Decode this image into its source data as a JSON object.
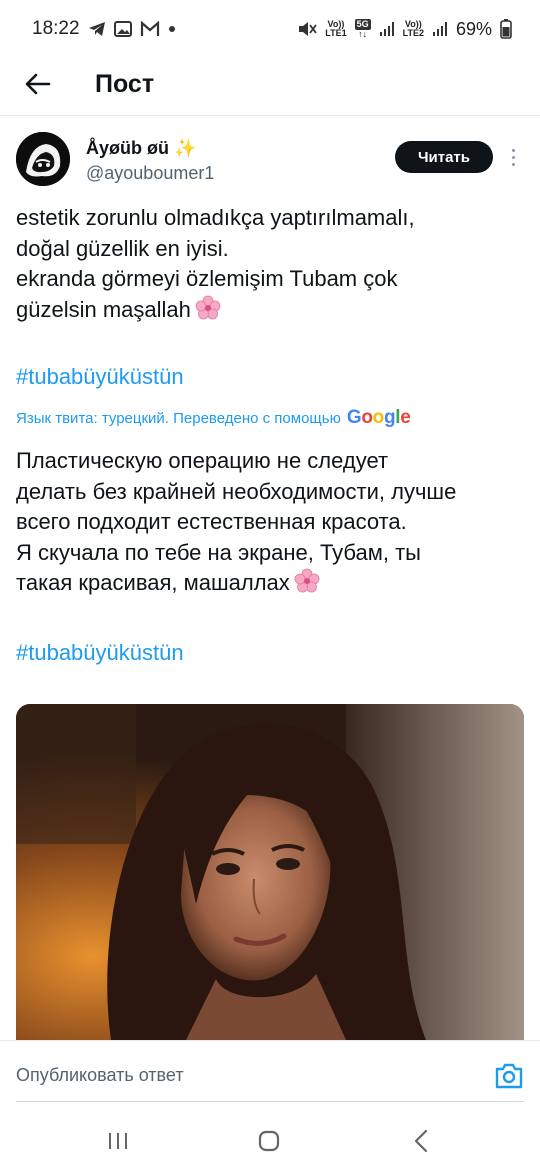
{
  "status_bar": {
    "time": "18:22",
    "battery": "69%",
    "volte1_top": "Vo))",
    "volte1_bottom": "LTE1",
    "network": "5G",
    "volte2_top": "Vo))",
    "volte2_bottom": "LTE2"
  },
  "header": {
    "title": "Пост"
  },
  "author": {
    "name": "Åyøüb øü ✨",
    "handle": "@ayouboumer1",
    "follow_label": "Читать"
  },
  "tweet": {
    "lines": [
      "estetik zorunlu olmadıkça yaptırılmamalı,",
      "doğal güzellik en iyisi.",
      "ekranda görmeyi özlemişim Tubam çok",
      "güzelsin maşallah"
    ],
    "hashtag": "#tubabüyüküstün"
  },
  "translation": {
    "note": "Язык твита: турецкий. Переведено с помощью",
    "provider": "Google",
    "lines": [
      "Пластическую операцию не следует",
      "делать без крайней необходимости, лучше",
      "всего подходит естественная красота.",
      "Я скучала по тебе на экране, Тубам, ты",
      "такая красивая, машаллах"
    ],
    "hashtag": "#tubabüyüküstün"
  },
  "reply": {
    "placeholder": "Опубликовать ответ"
  },
  "colors": {
    "link": "#1d9bf0",
    "text": "#0f1419",
    "muted": "#536471",
    "button_bg": "#0f1419"
  },
  "icons": [
    "back-arrow-icon",
    "more-vertical-icon",
    "camera-icon",
    "recents-icon",
    "home-icon",
    "back-icon",
    "cherry-blossom-icon"
  ]
}
